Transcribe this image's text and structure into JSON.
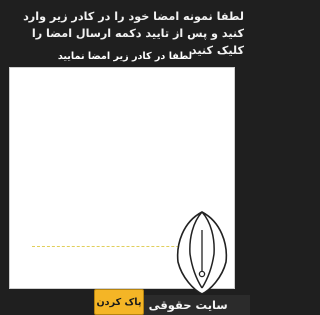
{
  "instructions": "لطفا نمونه امضا خود را در کادر زیر وارد کنید و پس از تایید دکمه ارسال امضا را کلیک کنید",
  "signature_pad": {
    "hint": "لطفا در کادر زیر امضا نمایید"
  },
  "buttons": {
    "clear_label": "پاک کردن"
  },
  "brand": {
    "text": "سایت حقوقی دینا"
  },
  "colors": {
    "background": "#1f1f1f",
    "pad": "#ffffff",
    "button": "#f4b526",
    "signature_line": "#e1cf5a"
  }
}
